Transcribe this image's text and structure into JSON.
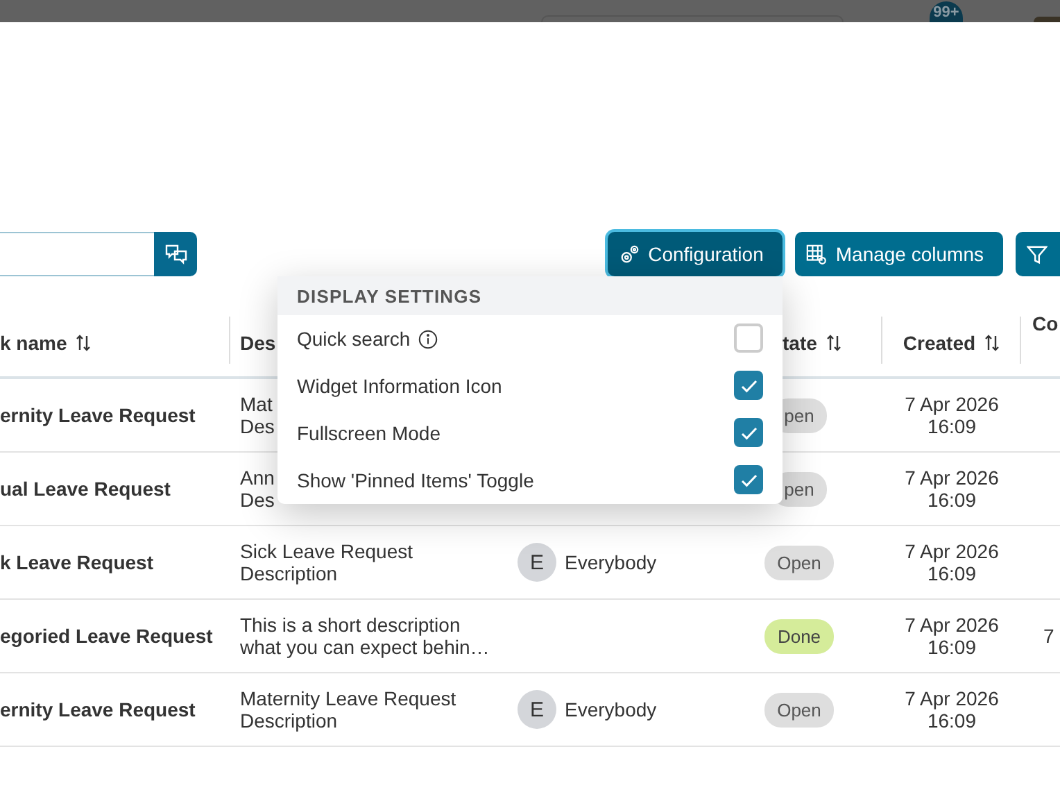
{
  "backdrop": {
    "badge": "99+"
  },
  "toolbar": {
    "buttons": [
      {
        "label": "Configuration",
        "active": true
      },
      {
        "label": "Manage columns",
        "active": false
      },
      {
        "active": false
      }
    ]
  },
  "table": {
    "columns": [
      {
        "label": "k name",
        "sortable": true
      },
      {
        "label": "Des",
        "sortable": false
      },
      {
        "label": "tate",
        "sortable": true
      },
      {
        "label": "Created",
        "sortable": true
      },
      {
        "label": "Co",
        "sortable": false
      }
    ],
    "rows": [
      {
        "task_name": "ernity Leave Request",
        "description": [
          "Mat",
          "Des"
        ],
        "state": {
          "label": "pen",
          "kind": "open"
        },
        "created": [
          "7 Apr 2026",
          "16:09"
        ]
      },
      {
        "task_name": "ual Leave Request",
        "description": [
          "Ann",
          "Des"
        ],
        "state": {
          "label": "pen",
          "kind": "open"
        },
        "created": [
          "7 Apr 2026",
          "16:09"
        ]
      },
      {
        "task_name": "k Leave Request",
        "description": [
          "Sick Leave Request",
          "Description"
        ],
        "responsible": {
          "initial": "E",
          "name": "Everybody"
        },
        "state": {
          "label": "Open",
          "kind": "open"
        },
        "created": [
          "7 Apr 2026",
          "16:09"
        ]
      },
      {
        "task_name": "egoried Leave Request",
        "description": [
          "This is a short description",
          "what you can expect behin…"
        ],
        "state": {
          "label": "Done",
          "kind": "done"
        },
        "created": [
          "7 Apr 2026",
          "16:09"
        ],
        "column_6": "7"
      },
      {
        "task_name": "ernity Leave Request",
        "description": [
          "Maternity Leave Request",
          "Description"
        ],
        "responsible": {
          "initial": "E",
          "name": "Everybody"
        },
        "state": {
          "label": "Open",
          "kind": "open"
        },
        "created": [
          "7 Apr 2026",
          "16:09"
        ]
      }
    ]
  },
  "dropdown": {
    "title": "DISPLAY SETTINGS",
    "items": [
      {
        "label": "Quick search",
        "info": true,
        "checked": false
      },
      {
        "label": "Widget Information Icon",
        "info": false,
        "checked": true
      },
      {
        "label": "Fullscreen Mode",
        "info": false,
        "checked": true
      },
      {
        "label": "Show 'Pinned Items' Toggle",
        "info": false,
        "checked": true
      }
    ]
  }
}
